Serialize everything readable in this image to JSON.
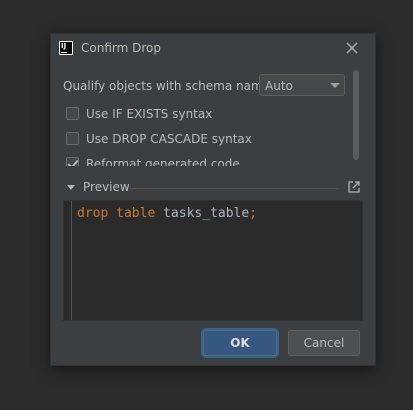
{
  "dialog": {
    "title": "Confirm Drop",
    "app_icon": "intellij-icon",
    "close_icon": "close-icon"
  },
  "qualify": {
    "label": "Qualify objects with schema names:",
    "selected": "Auto"
  },
  "options": [
    {
      "label": "Use IF EXISTS syntax",
      "checked": false
    },
    {
      "label": "Use DROP CASCADE syntax",
      "checked": false
    },
    {
      "label": "Reformat generated code",
      "checked": true
    }
  ],
  "preview": {
    "label": "Preview",
    "open_icon": "open-in-new-window-icon",
    "code": {
      "kw1": "drop",
      "kw2": "table",
      "identifier": "tasks_table",
      "terminator": ";"
    }
  },
  "buttons": {
    "ok": "OK",
    "cancel": "Cancel"
  },
  "colors": {
    "keyword": "#cc7832",
    "identifier": "#a9b7c6",
    "default_button": "#365880"
  }
}
